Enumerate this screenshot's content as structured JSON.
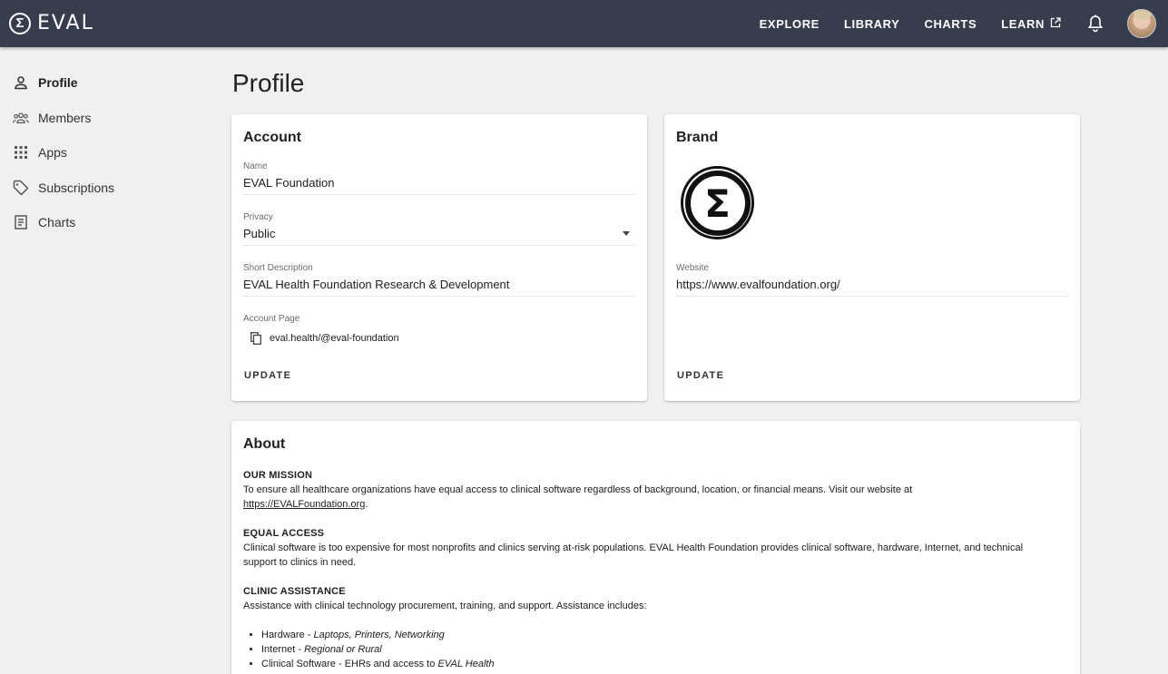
{
  "brand": {
    "logo_text": "EVAL",
    "logo_symbol": "Σ"
  },
  "nav": {
    "explore": "EXPLORE",
    "library": "LIBRARY",
    "charts": "CHARTS",
    "learn": "LEARN"
  },
  "sidebar": {
    "items": [
      {
        "label": "Profile",
        "icon": "person-icon",
        "active": true
      },
      {
        "label": "Members",
        "icon": "group-icon",
        "active": false
      },
      {
        "label": "Apps",
        "icon": "grid-icon",
        "active": false
      },
      {
        "label": "Subscriptions",
        "icon": "tag-icon",
        "active": false
      },
      {
        "label": "Charts",
        "icon": "document-icon",
        "active": false
      }
    ]
  },
  "page": {
    "title": "Profile"
  },
  "account": {
    "title": "Account",
    "name_label": "Name",
    "name_value": "EVAL Foundation",
    "privacy_label": "Privacy",
    "privacy_value": "Public",
    "short_desc_label": "Short Description",
    "short_desc_value": "EVAL Health Foundation Research & Development",
    "account_page_label": "Account Page",
    "account_page_value": "eval.health/@eval-foundation",
    "update_label": "UPDATE"
  },
  "brand_card": {
    "title": "Brand",
    "logo_symbol": "Σ",
    "website_label": "Website",
    "website_value": "https://www.evalfoundation.org/",
    "update_label": "UPDATE"
  },
  "about": {
    "title": "About",
    "mission_title": "OUR MISSION",
    "mission_text": "To ensure all healthcare organizations have equal access to clinical software regardless of background, location, or financial means. Visit our website at",
    "mission_link": "https://EVALFoundation.org",
    "mission_end": ".",
    "equal_title": "EQUAL ACCESS",
    "equal_text": "Clinical software is too expensive for most nonprofits and clinics serving at-risk populations. EVAL Health Foundation provides clinical software, hardware, Internet, and technical support to clinics in need.",
    "clinic_title": "CLINIC ASSISTANCE",
    "clinic_text": "Assistance with clinical technology procurement, training, and support. Assistance includes:",
    "list": [
      {
        "head": "Hardware - ",
        "detail": "Laptops, Printers, Networking"
      },
      {
        "head": "Internet - ",
        "detail": "Regional or Rural"
      },
      {
        "head": "Clinical Software - EHRs and access to ",
        "detail": "EVAL Health"
      }
    ]
  },
  "colors": {
    "topbar": "#383d4d",
    "background": "#f0f0f0",
    "card": "#ffffff"
  }
}
